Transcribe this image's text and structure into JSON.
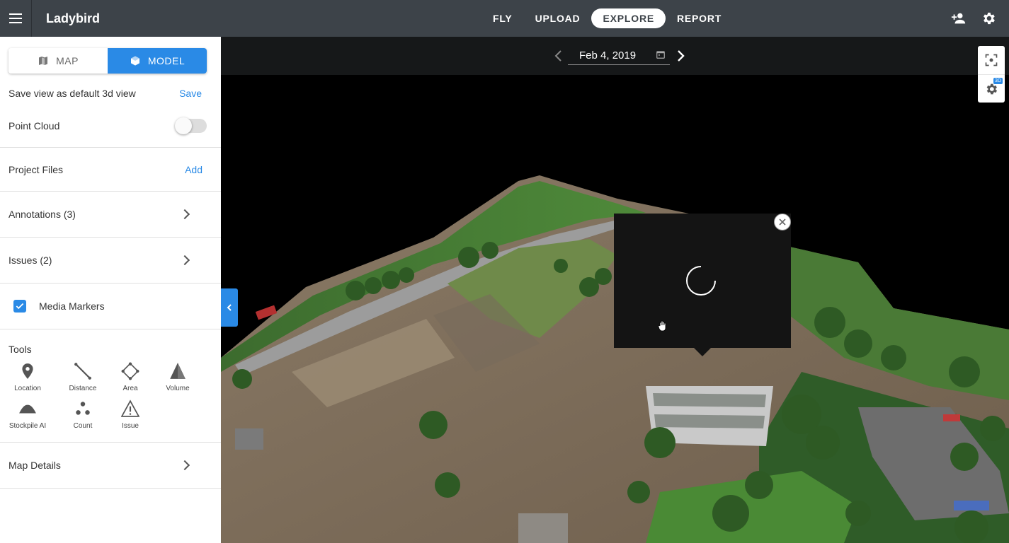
{
  "app": {
    "title": "Ladybird"
  },
  "nav": [
    {
      "label": "FLY",
      "active": false
    },
    {
      "label": "UPLOAD",
      "active": false
    },
    {
      "label": "EXPLORE",
      "active": true
    },
    {
      "label": "REPORT",
      "active": false
    }
  ],
  "topbar_icons": [
    "add-user-icon",
    "gear-icon"
  ],
  "view_toggle": {
    "map_label": "MAP",
    "model_label": "MODEL",
    "selected": "MODEL"
  },
  "sidebar": {
    "save_view_label": "Save view as default 3d view",
    "save_link": "Save",
    "point_cloud_label": "Point Cloud",
    "point_cloud_enabled": false,
    "project_files_label": "Project Files",
    "add_link": "Add",
    "annotations_label": "Annotations (3)",
    "issues_label": "Issues (2)",
    "media_markers_label": "Media Markers",
    "media_markers_checked": true,
    "tools_label": "Tools",
    "tools": [
      {
        "label": "Location",
        "icon": "location-pin-icon"
      },
      {
        "label": "Distance",
        "icon": "distance-line-icon"
      },
      {
        "label": "Area",
        "icon": "area-polygon-icon"
      },
      {
        "label": "Volume",
        "icon": "volume-cone-icon"
      },
      {
        "label": "Stockpile AI",
        "icon": "stockpile-icon"
      },
      {
        "label": "Count",
        "icon": "count-dots-icon"
      },
      {
        "label": "Issue",
        "icon": "warning-triangle-icon"
      }
    ],
    "map_details_label": "Map Details"
  },
  "date_picker": {
    "value": "Feb 4, 2019"
  },
  "viewer_controls": {
    "settings_badge": "3D"
  },
  "colors": {
    "accent": "#2a8ae6",
    "topbar": "#3d4349",
    "datebar": "#161819"
  }
}
